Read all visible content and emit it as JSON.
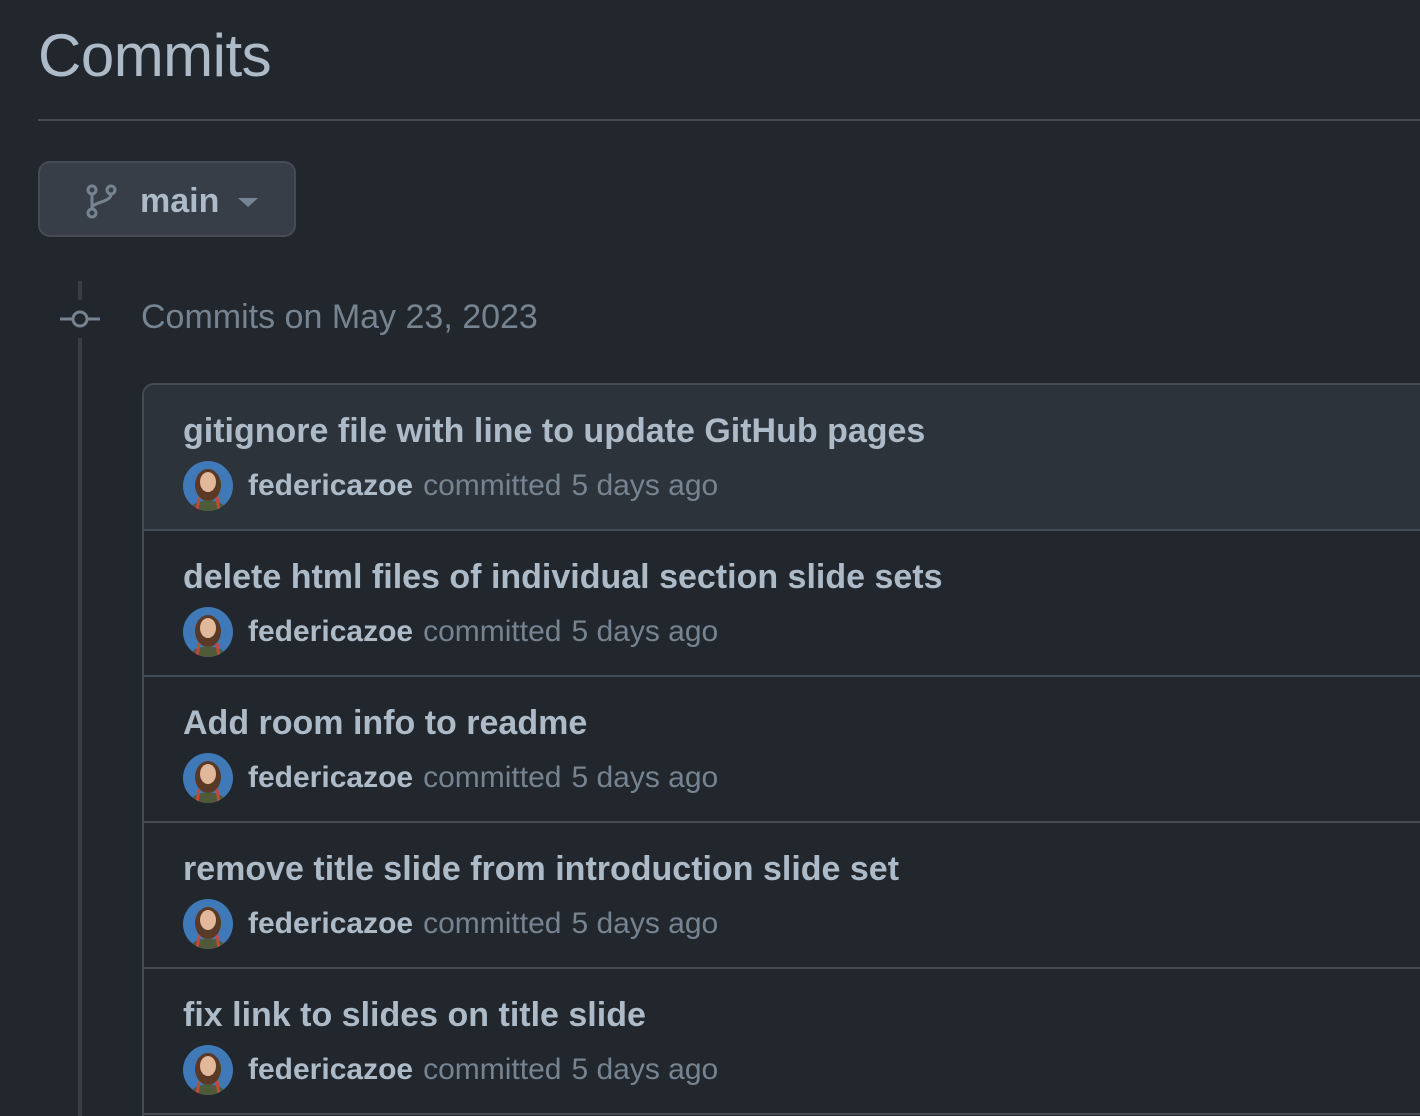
{
  "page": {
    "title": "Commits"
  },
  "branch": {
    "name": "main",
    "icon": "git-branch-icon"
  },
  "group": {
    "heading": "Commits on May 23, 2023",
    "icon": "git-commit-icon"
  },
  "commits": [
    {
      "message": "gitignore file with line to update GitHub pages",
      "author": "federicazoe",
      "action": "committed",
      "time": "5 days ago"
    },
    {
      "message": "delete html files of individual section slide sets",
      "author": "federicazoe",
      "action": "committed",
      "time": "5 days ago"
    },
    {
      "message": "Add room info to readme",
      "author": "federicazoe",
      "action": "committed",
      "time": "5 days ago"
    },
    {
      "message": "remove title slide from introduction slide set",
      "author": "federicazoe",
      "action": "committed",
      "time": "5 days ago"
    },
    {
      "message": "fix link to slides on title slide",
      "author": "federicazoe",
      "action": "committed",
      "time": "5 days ago"
    }
  ],
  "colors": {
    "background": "#22272e",
    "border": "#444c56",
    "text": "#adbac7",
    "muted": "#768390",
    "row_hover": "#2d333b"
  }
}
